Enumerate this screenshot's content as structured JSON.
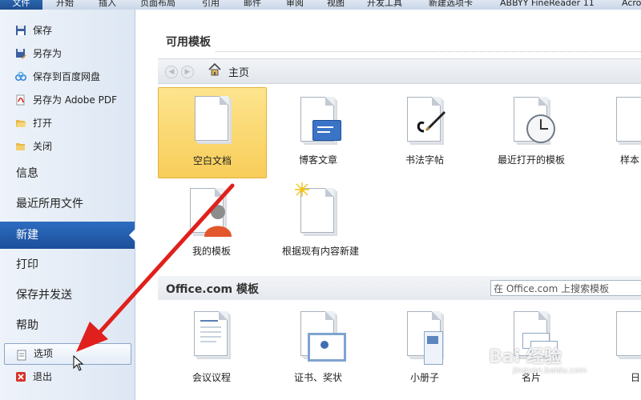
{
  "ribbon": {
    "tabs": [
      "文件",
      "开始",
      "插入",
      "页面布局",
      "引用",
      "邮件",
      "审阅",
      "视图",
      "开发工具",
      "新建选项卡",
      "ABBYY FineReader 11",
      "Acro"
    ]
  },
  "nav": {
    "commands": [
      {
        "label": "保存",
        "icon": "save-icon"
      },
      {
        "label": "另存为",
        "icon": "save-as-icon"
      },
      {
        "label": "保存到百度网盘",
        "icon": "baidu-cloud-icon"
      },
      {
        "label": "另存为 Adobe PDF",
        "icon": "pdf-icon"
      },
      {
        "label": "打开",
        "icon": "open-folder-icon"
      },
      {
        "label": "关闭",
        "icon": "close-folder-icon"
      }
    ],
    "sections": [
      "信息",
      "最近所用文件",
      "新建",
      "打印",
      "保存并发送",
      "帮助"
    ],
    "active_section": "新建",
    "options_label": "选项",
    "exit_label": "退出"
  },
  "main": {
    "available_title": "可用模板",
    "home_label": "主页",
    "templates": [
      {
        "label": "空白文档",
        "icon": "blank-document-icon",
        "selected": true
      },
      {
        "label": "博客文章",
        "icon": "blog-post-icon"
      },
      {
        "label": "书法字帖",
        "icon": "calligraphy-icon"
      },
      {
        "label": "最近打开的模板",
        "icon": "recent-templates-icon"
      },
      {
        "label": "样本",
        "icon": "sample-templates-icon"
      },
      {
        "label": "我的模板",
        "icon": "my-templates-icon"
      },
      {
        "label": "根据现有内容新建",
        "icon": "new-from-existing-icon"
      }
    ],
    "office_title": "Office.com 模板",
    "search_placeholder": "在 Office.com 上搜索模板",
    "office_templates": [
      {
        "label": "会议议程",
        "icon": "agenda-icon"
      },
      {
        "label": "证书、奖状",
        "icon": "certificate-icon"
      },
      {
        "label": "小册子",
        "icon": "brochure-icon"
      },
      {
        "label": "名片",
        "icon": "business-card-icon"
      },
      {
        "label": "日",
        "icon": "calendar-icon"
      }
    ]
  },
  "watermark": {
    "text": "Bai 经验",
    "sub": "jingyan.baidu.com"
  },
  "colors": {
    "accent": "#1e56a6",
    "selected_tile": "#f8cd59",
    "arrow": "#e0201c"
  }
}
